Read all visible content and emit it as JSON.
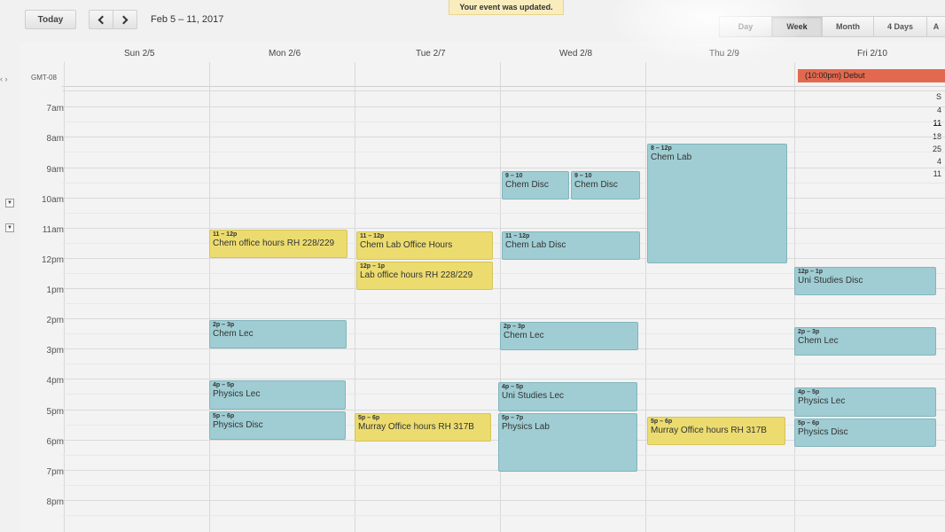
{
  "toolbar": {
    "today_label": "Today",
    "date_range": "Feb 5 – 11, 2017",
    "toast": "Your event was updated.",
    "prev_icon": "chevron-left-icon",
    "next_icon": "chevron-right-icon"
  },
  "views": [
    {
      "label": "Day",
      "active": false
    },
    {
      "label": "Week",
      "active": true
    },
    {
      "label": "Month",
      "active": false
    },
    {
      "label": "4 Days",
      "active": false
    },
    {
      "label": "A",
      "active": false
    }
  ],
  "mini_calendar": {
    "nav": "‹ ›",
    "items": [
      "S",
      "4",
      "11",
      "18",
      "25",
      "4",
      "11"
    ]
  },
  "timezone": "GMT-08",
  "days": [
    "Sun 2/5",
    "Mon 2/6",
    "Tue 2/7",
    "Wed 2/8",
    "Thu 2/9",
    "Fri 2/10"
  ],
  "hours": [
    "7am",
    "8am",
    "9am",
    "10am",
    "11am",
    "12pm",
    "1pm",
    "2pm",
    "3pm",
    "4pm",
    "5pm",
    "6pm",
    "7pm",
    "8pm"
  ],
  "allday_event": "(10:00pm) Debut",
  "events": [
    {
      "time": "11 – 12p",
      "title": "Chem office hours RH 228/229",
      "color": "yellow"
    },
    {
      "time": "2p – 3p",
      "title": "Chem Lec",
      "color": "teal"
    },
    {
      "time": "4p – 5p",
      "title": "Physics Lec",
      "color": "teal"
    },
    {
      "time": "5p – 6p",
      "title": "Physics Disc",
      "color": "teal"
    },
    {
      "time": "11 – 12p",
      "title": "Chem Lab Office Hours",
      "color": "yellow"
    },
    {
      "time": "12p – 1p",
      "title": "Lab office hours RH 228/229",
      "color": "yellow"
    },
    {
      "time": "5p – 6p",
      "title": "Murray Office hours RH 317B",
      "color": "yellow"
    },
    {
      "time": "9 – 10",
      "title": "Chem Disc",
      "color": "teal"
    },
    {
      "time": "9 – 10",
      "title": "Chem Disc",
      "color": "teal"
    },
    {
      "time": "11 – 12p",
      "title": "Chem Lab Disc",
      "color": "teal"
    },
    {
      "time": "2p – 3p",
      "title": "Chem Lec",
      "color": "teal"
    },
    {
      "time": "4p – 5p",
      "title": "Uni Studies Lec",
      "color": "teal"
    },
    {
      "time": "5p – 7p",
      "title": "Physics Lab",
      "color": "teal"
    },
    {
      "time": "8 – 12p",
      "title": "Chem Lab",
      "color": "teal"
    },
    {
      "time": "5p – 6p",
      "title": "Murray Office hours RH 317B",
      "color": "yellow"
    },
    {
      "time": "12p – 1p",
      "title": "Uni Studies Disc",
      "color": "teal"
    },
    {
      "time": "2p – 3p",
      "title": "Chem Lec",
      "color": "teal"
    },
    {
      "time": "4p – 5p",
      "title": "Physics Lec",
      "color": "teal"
    },
    {
      "time": "5p – 6p",
      "title": "Physics Disc",
      "color": "teal"
    }
  ],
  "colors": {
    "teal": "#9fcdd3",
    "yellow": "#ecdc70",
    "allday": "#e2694f"
  }
}
